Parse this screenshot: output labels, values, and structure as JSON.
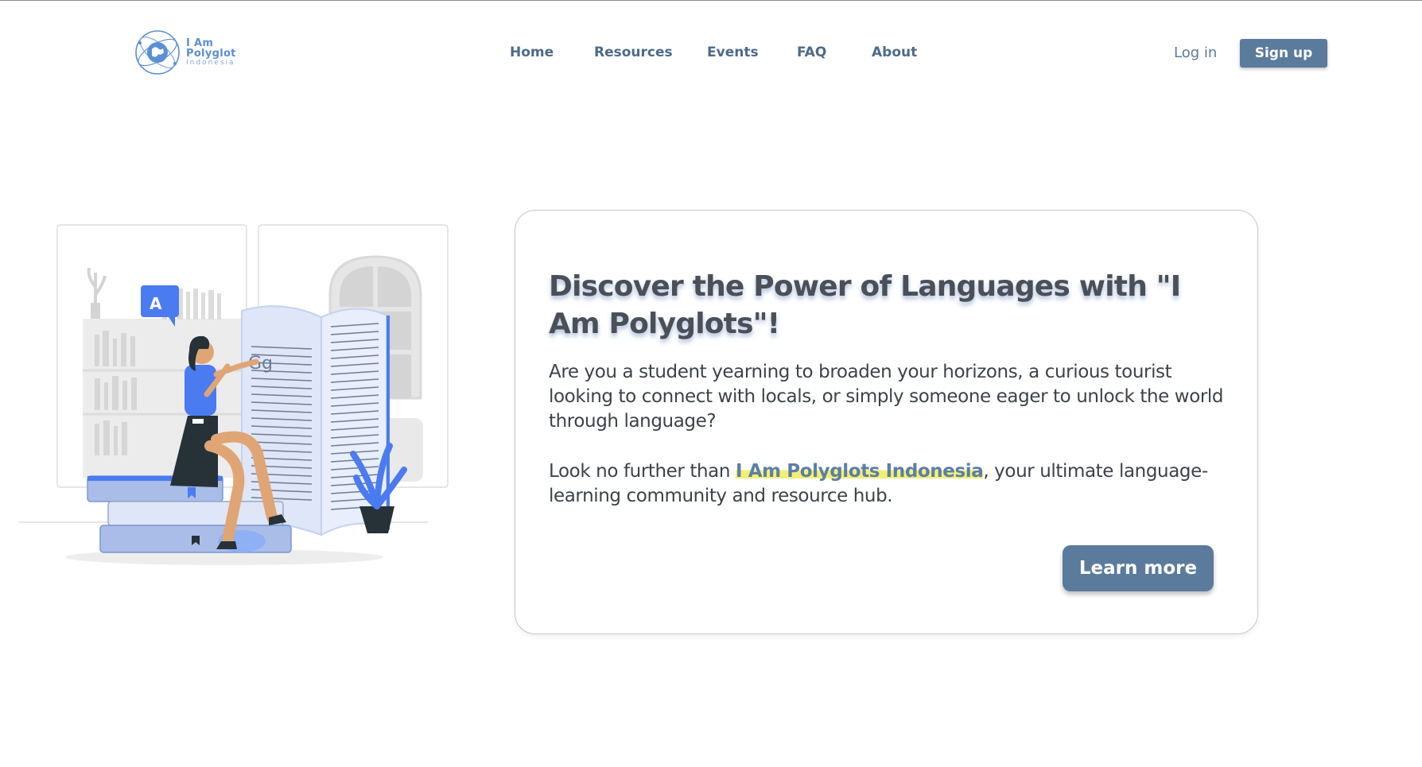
{
  "header": {
    "logo": {
      "line1": "I Am",
      "line2": "Polyglot",
      "line3": "Indonesia"
    },
    "nav": [
      {
        "label": "Home"
      },
      {
        "label": "Resources"
      },
      {
        "label": "Events"
      },
      {
        "label": "FAQ"
      },
      {
        "label": "About"
      }
    ],
    "login_label": "Log in",
    "signup_label": "Sign up"
  },
  "hero": {
    "illustration": {
      "book_letters": "Gg",
      "translate_badge": "A"
    },
    "title": "Discover the Power of Languages with \"I Am Polyglots\"!",
    "paragraph1": "Are you a student yearning to broaden your horizons, a curious tourist looking to connect with locals, or simply someone eager to unlock the world through language?",
    "paragraph2_before": "Look no further than ",
    "paragraph2_brand": "I Am Polyglots Indonesia",
    "paragraph2_after": ", your ultimate language-learning community and resource hub.",
    "cta_label": "Learn more"
  },
  "colors": {
    "accent": "#5b7b9d",
    "nav_text": "#4d6a89",
    "brand_blue": "#5b8fd4",
    "highlight": "#f3ef74",
    "illustration_blue": "#4a7bf0"
  }
}
